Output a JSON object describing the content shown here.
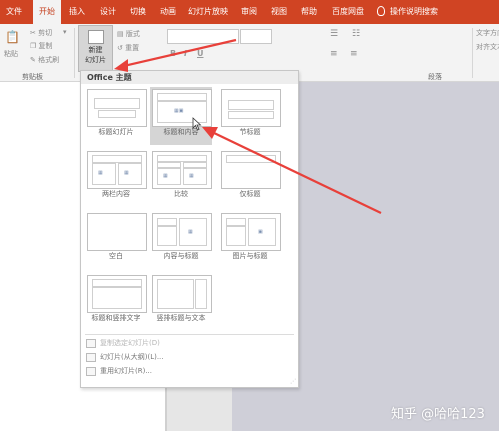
{
  "tabs": [
    "文件",
    "开始",
    "插入",
    "设计",
    "切换",
    "动画",
    "幻灯片放映",
    "审阅",
    "视图",
    "帮助",
    "百度网盘",
    "操作说明搜索"
  ],
  "active_tab": "开始",
  "ribbon": {
    "paste": "粘贴",
    "cut": "剪切",
    "copy": "复制",
    "format_painter": "格式刷",
    "clipboard_group": "剪贴板",
    "new_slide_line1": "新建",
    "new_slide_line2": "幻灯片",
    "layout": "版式",
    "reset": "重置",
    "bold": "B",
    "italic": "I",
    "underline": "U",
    "paragraph_group": "段落",
    "text_direction": "文字方向",
    "align_text": "对齐文本"
  },
  "dropdown": {
    "header": "Office 主题",
    "layouts": [
      {
        "label": "标题幻灯片"
      },
      {
        "label": "标题和内容"
      },
      {
        "label": "节标题"
      },
      {
        "label": "两栏内容"
      },
      {
        "label": "比较"
      },
      {
        "label": "仅标题"
      },
      {
        "label": "空白"
      },
      {
        "label": "内容与标题"
      },
      {
        "label": "图片与标题"
      },
      {
        "label": "标题和竖排文字"
      },
      {
        "label": "竖排标题与文本"
      }
    ],
    "selected_layout": "标题和内容",
    "menu": [
      {
        "label": "复制选定幻灯片(D)",
        "disabled": true
      },
      {
        "label": "幻灯片(从大纲)(L)...",
        "disabled": false
      },
      {
        "label": "重用幻灯片(R)...",
        "disabled": false
      }
    ]
  },
  "watermark": "知乎 @哈哈123",
  "colors": {
    "accent": "#d04423",
    "annotation_arrow": "#e8403a"
  }
}
